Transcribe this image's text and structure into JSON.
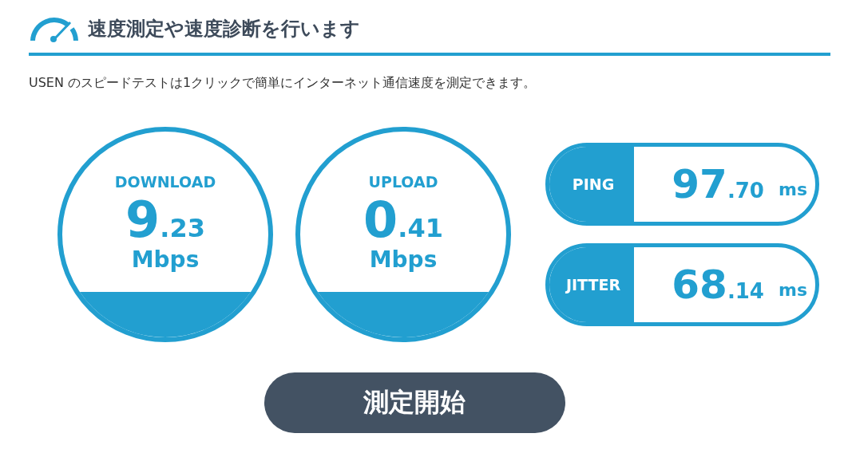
{
  "header": {
    "title": "速度測定や速度診断を行います"
  },
  "description": "USEN のスピードテストは1クリックで簡単にインターネット通信速度を測定できます。",
  "gauges": [
    {
      "label": "DOWNLOAD",
      "whole": "9",
      "fraction": ".23",
      "unit": "Mbps"
    },
    {
      "label": "UPLOAD",
      "whole": "0",
      "fraction": ".41",
      "unit": "Mbps"
    }
  ],
  "metrics": [
    {
      "label": "PING",
      "whole": "97",
      "fraction": ".70",
      "unit": "ms"
    },
    {
      "label": "JITTER",
      "whole": "68",
      "fraction": ".14",
      "unit": "ms"
    }
  ],
  "start_button": "測定開始"
}
